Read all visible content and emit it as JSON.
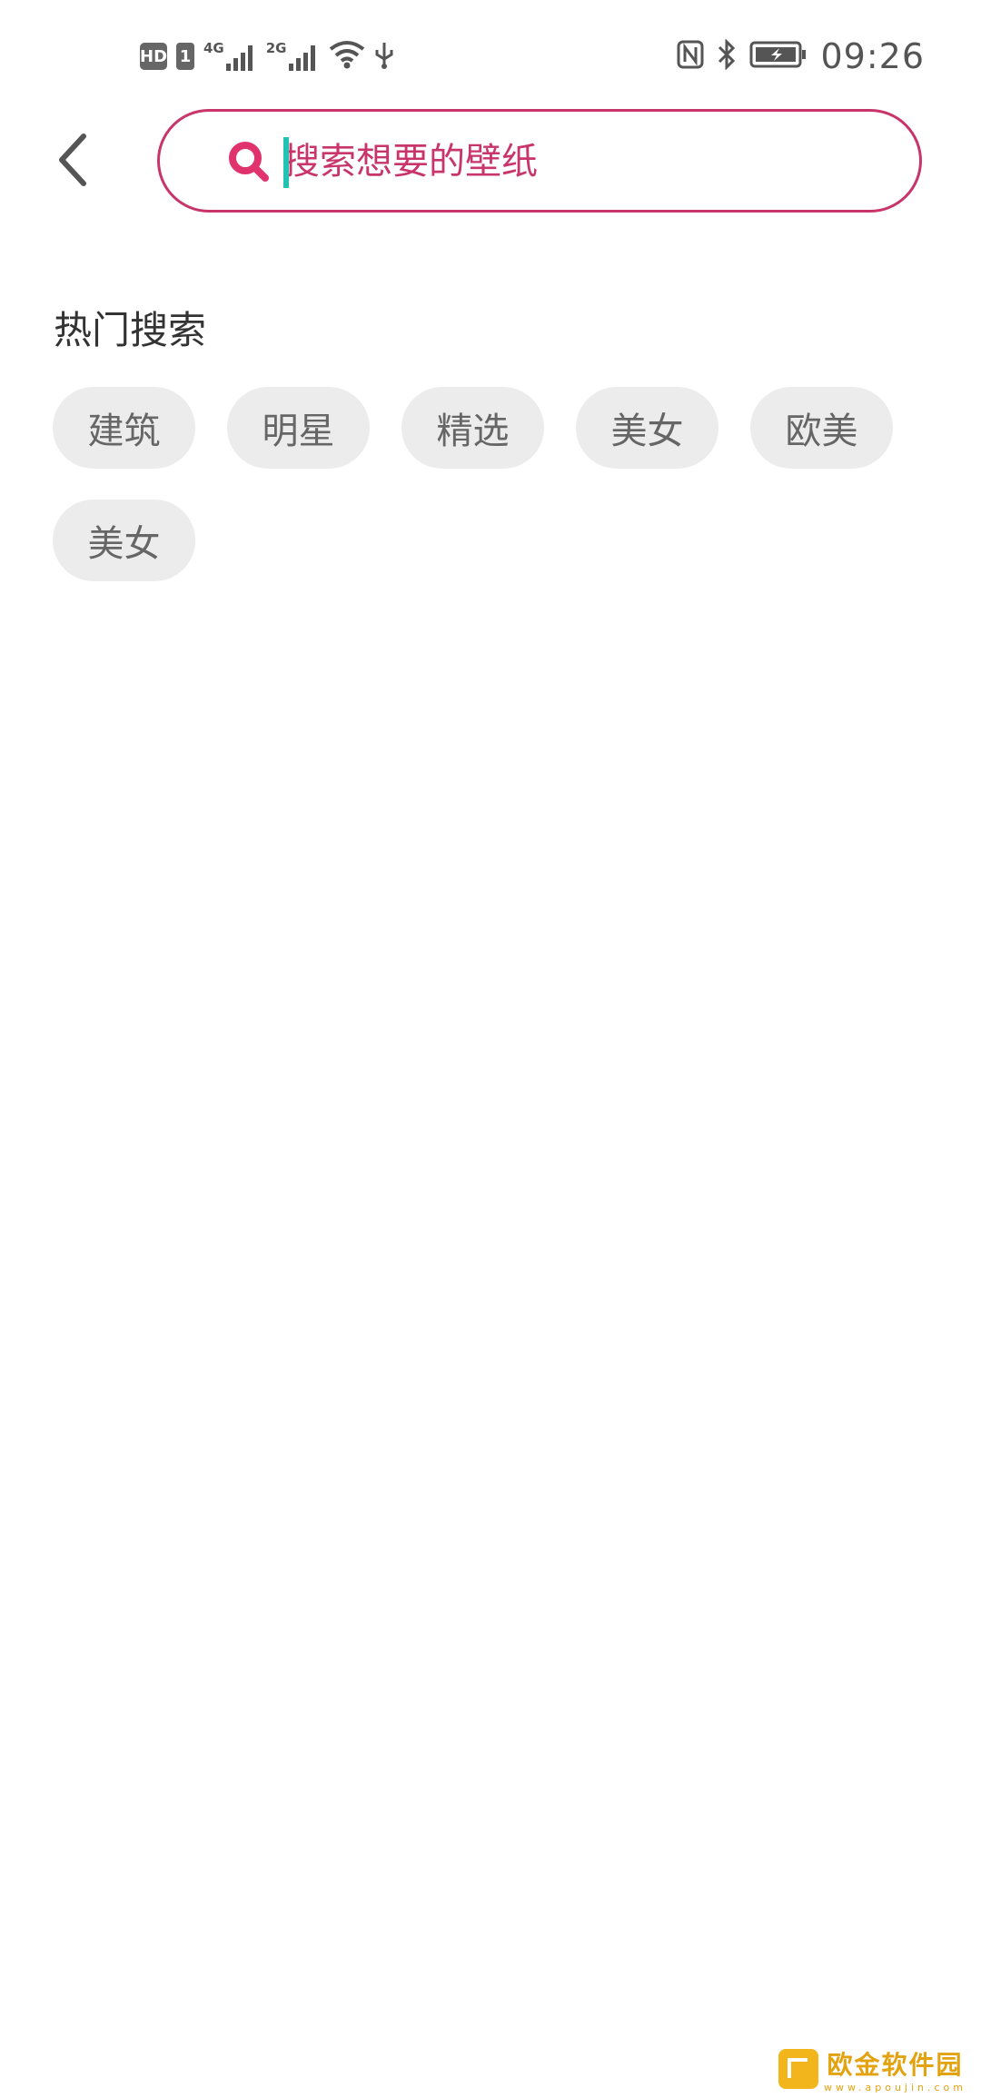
{
  "status_bar": {
    "hd_label": "HD",
    "sim_label": "1",
    "network_primary": "4G",
    "network_secondary": "2G",
    "time": "09:26",
    "icons": [
      "hd-icon",
      "sim-1-icon",
      "signal-4g-icon",
      "signal-2g-icon",
      "wifi-icon",
      "usb-icon",
      "nfc-icon",
      "bluetooth-icon",
      "battery-charging-icon"
    ]
  },
  "header": {
    "back_icon": "chevron-left-icon",
    "search": {
      "placeholder": "搜索想要的壁纸",
      "value": "",
      "icon": "search-icon"
    }
  },
  "hot_search": {
    "title": "热门搜索",
    "tags": [
      "建筑",
      "明星",
      "精选",
      "美女",
      "欧美",
      "美女"
    ]
  },
  "watermark": {
    "name": "欧金软件园",
    "url": "www.apoujin.com"
  },
  "colors": {
    "accent": "#c8356a",
    "search_icon": "#e0336e",
    "caret": "#22c3b1",
    "tag_bg": "#ececec",
    "tag_text": "#666666",
    "title_text": "#333333"
  }
}
